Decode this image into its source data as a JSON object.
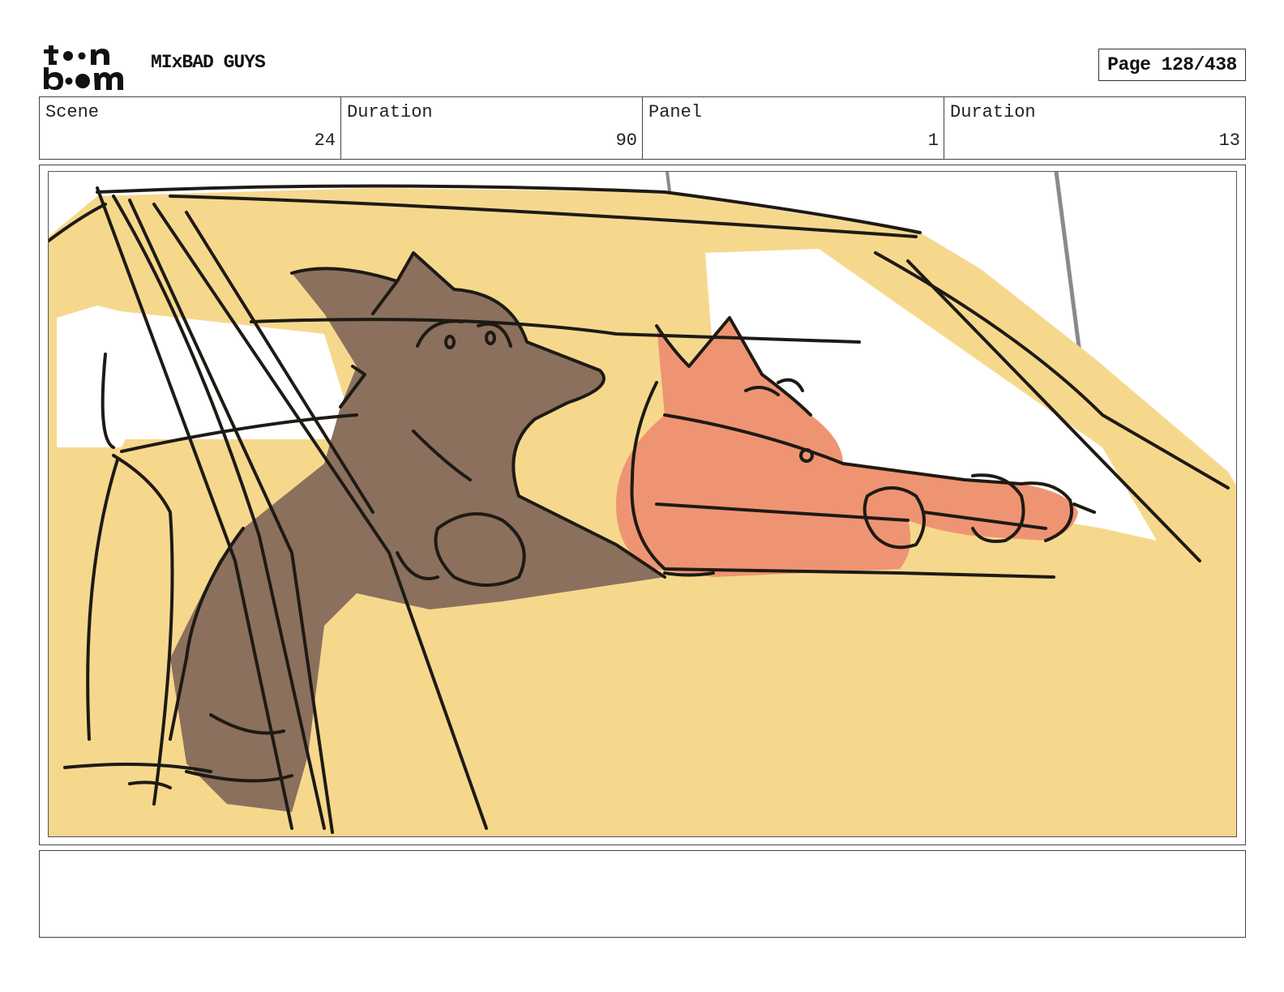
{
  "header": {
    "logo_text": "toon boom",
    "project_title": "MIxBAD GUYS",
    "page_label": "Page 128/438"
  },
  "info": {
    "scene_label": "Scene",
    "scene_value": "24",
    "scene_duration_label": "Duration",
    "scene_duration_value": "90",
    "panel_label": "Panel",
    "panel_value": "1",
    "panel_duration_label": "Duration",
    "panel_duration_value": "13"
  },
  "panel": {
    "image": "storyboard-sketch-wolf-and-cat-in-car",
    "colors": {
      "car": "#f6d88d",
      "wolf": "#8b705e",
      "cat": "#ef9472",
      "line": "#1e1a14"
    }
  },
  "notes": {
    "text": ""
  }
}
